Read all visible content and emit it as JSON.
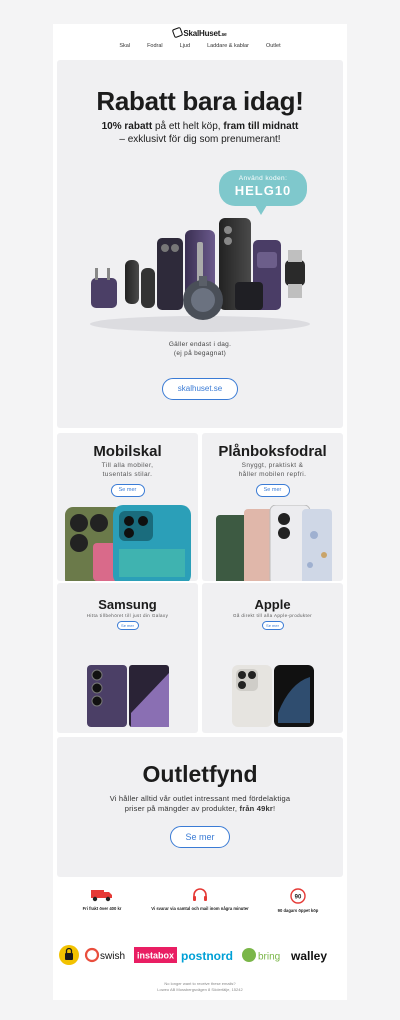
{
  "brand": {
    "name": "SkalHuset",
    "tld": ".se"
  },
  "nav": [
    "Skal",
    "Fodral",
    "Ljud",
    "Laddare & kablar",
    "Outlet"
  ],
  "hero": {
    "title": "Rabatt bara idag!",
    "sub_bold_1": "10% rabatt",
    "sub_text_1": " på ett helt köp, ",
    "sub_bold_2": "fram till midnatt",
    "sub_line_2": "– exklusivt för dig som prenumerant!",
    "bubble_small": "Använd koden:",
    "bubble_code": "HELG10",
    "valid_line_1": "Gäller endast i dag.",
    "valid_line_2": "(ej på begagnat)",
    "button": "skalhuset.se"
  },
  "cards": [
    {
      "title": "Mobilskal",
      "desc_1": "Till alla mobiler,",
      "desc_2": "tusentals stilar.",
      "button": "Se mer"
    },
    {
      "title": "Plånboksfodral",
      "desc_1": "Snyggt, praktiskt &",
      "desc_2": "håller mobilen repfri.",
      "button": "Se mer"
    },
    {
      "title": "Samsung",
      "desc_1": "Hitta tillbehöret till just din Galaxy",
      "button": "Se mer"
    },
    {
      "title": "Apple",
      "desc_1": "Gå direkt till alla Apple-produkter",
      "button": "Se mer"
    }
  ],
  "outlet": {
    "title": "Outletfynd",
    "desc_1": "Vi håller alltid vår outlet intressant med fördelaktiga",
    "desc_2": "priser på mängder av produkter, ",
    "desc_bold": "från 49kr",
    "desc_end": "!",
    "button": "Se mer"
  },
  "usp": [
    {
      "icon": "delivery-truck-icon",
      "text": "Fri frakt över 400 kr"
    },
    {
      "icon": "headphones-icon",
      "text": "Vi svarar via samtal och mail inom några minuter"
    },
    {
      "icon": "return-90-days-icon",
      "text": "90 dagars öppet köp",
      "badge": "90"
    }
  ],
  "partners": [
    "Trygg e-handel",
    "swish",
    "instabox",
    "postnord",
    "bring",
    "walley"
  ],
  "footer": {
    "line_1": "No longer want to receive these emails?",
    "line_2": "Loweo AB Mossbergsvägen 8 Södertälje, 15242"
  },
  "colors": {
    "accent": "#3a7bd5",
    "bubble": "#7fc8cc",
    "panel": "#f0f0f2",
    "truck": "#e53935",
    "instabox": "#e91e63",
    "postnord": "#00a0d6",
    "bring": "#7ab648"
  }
}
